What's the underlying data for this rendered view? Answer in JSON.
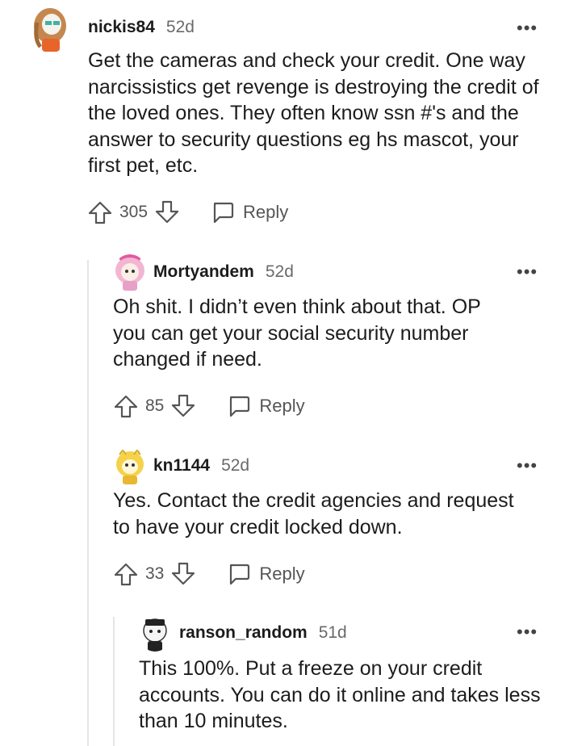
{
  "comments": [
    {
      "username": "nickis84",
      "age": "52d",
      "body": "Get the cameras and check your credit. One way narcissistics get revenge is destroying the credit of the loved ones. They often know ssn #'s and the answer to security questions eg hs mascot, your first pet, etc.",
      "score": "305",
      "reply_label": "Reply",
      "more_label": "•••"
    },
    {
      "username": "Mortyandem",
      "age": "52d",
      "body": "Oh shit. I didn’t even think about that. OP you can get your social security number changed if need.",
      "score": "85",
      "reply_label": "Reply",
      "more_label": "•••"
    },
    {
      "username": "kn1144",
      "age": "52d",
      "body": "Yes. Contact the credit agencies and request to have your credit locked down.",
      "score": "33",
      "reply_label": "Reply",
      "more_label": "•••"
    },
    {
      "username": "ranson_random",
      "age": "51d",
      "body": "This 100%. Put a freeze on your credit accounts. You can do it online and takes less than 10 minutes.",
      "more_label": "•••"
    }
  ],
  "icons": {
    "upvote": "arrow-up-icon",
    "downvote": "arrow-down-icon",
    "reply": "speech-bubble-icon",
    "more": "more-dots-icon"
  }
}
